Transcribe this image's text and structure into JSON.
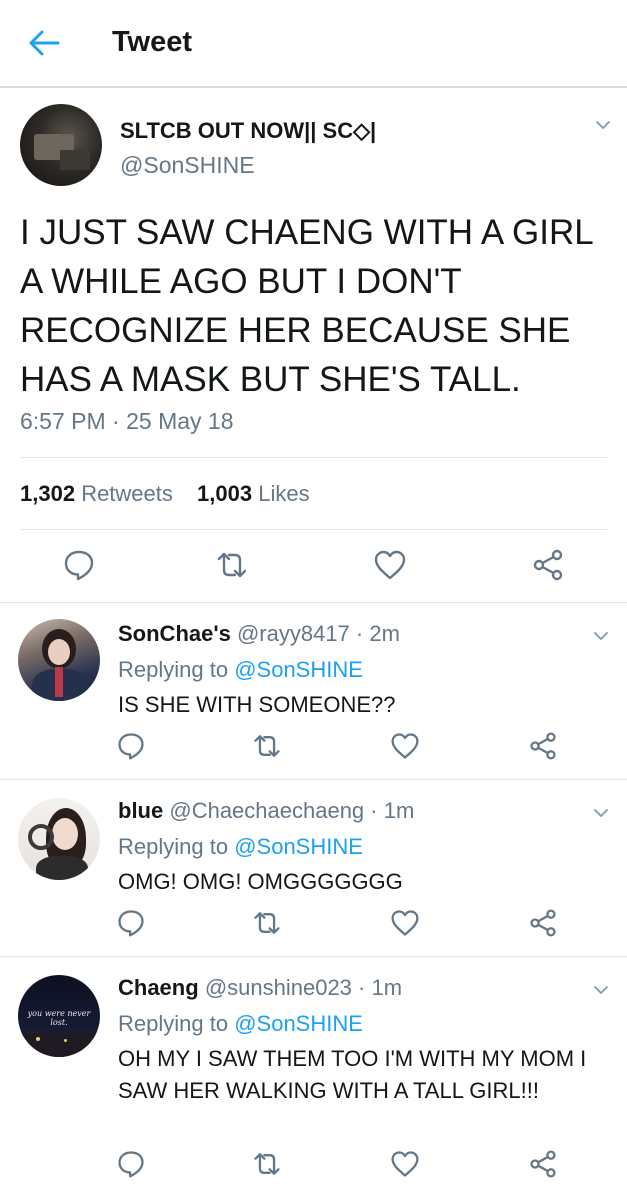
{
  "header": {
    "title": "Tweet"
  },
  "tweet": {
    "name": "SLTCB OUT NOW|| SC◇|",
    "handle": "@SonSHINE",
    "text": "I JUST SAW CHAENG WITH A GIRL A WHILE AGO BUT I DON'T RECOGNIZE HER BECAUSE SHE HAS A MASK BUT SHE'S TALL.",
    "time": "6:57 PM · 25 May 18",
    "retweets_count": "1,302",
    "retweets_label": "Retweets",
    "likes_count": "1,003",
    "likes_label": "Likes"
  },
  "replies": [
    {
      "name": "SonChae's",
      "handle": "@rayy8417",
      "time": "· 2m",
      "replying_prefix": "Replying to",
      "replying_to": "@SonSHINE",
      "text": "IS SHE WITH SOMEONE??"
    },
    {
      "name": "blue",
      "handle": "@Chaechaechaeng",
      "time": "· 1m",
      "replying_prefix": "Replying to",
      "replying_to": "@SonSHINE",
      "text": "OMG! OMG! OMGGGGGGG"
    },
    {
      "name": "Chaeng",
      "handle": "@sunshine023",
      "time": "· 1m",
      "replying_prefix": "Replying to",
      "replying_to": "@SonSHINE",
      "text": "OH MY I SAW THEM TOO I'M WITH MY MOM I SAW HER WALKING WITH A TALL GIRL!!!",
      "avatar_text": "you were never lost."
    }
  ],
  "colors": {
    "accent": "#1da1f2",
    "secondary_text": "#657786",
    "icon": "#657786"
  }
}
